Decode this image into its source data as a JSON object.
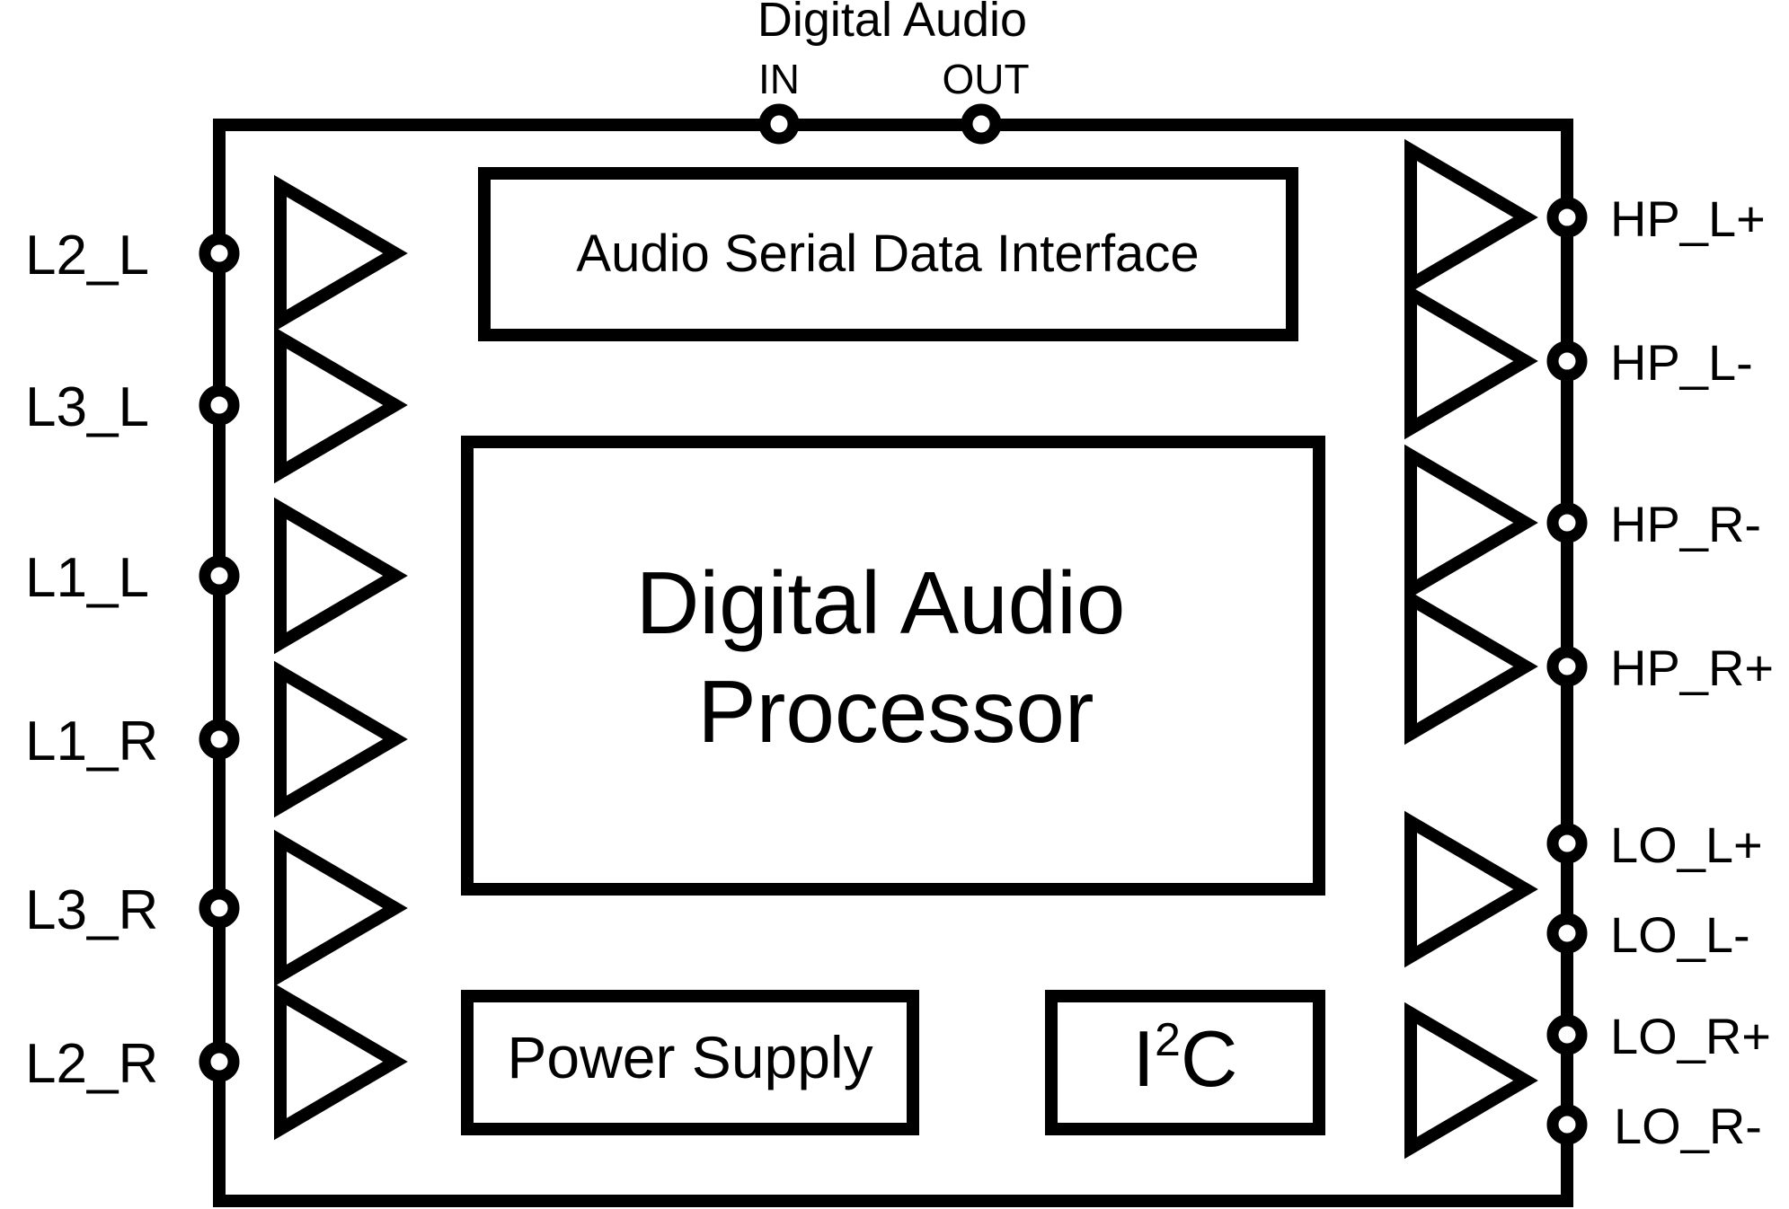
{
  "diagram": {
    "colors": {
      "stroke": "#000000",
      "background": "#ffffff"
    },
    "top_header": "Digital Audio",
    "top_pins": [
      {
        "id": "in",
        "label": "IN"
      },
      {
        "id": "out",
        "label": "OUT"
      }
    ],
    "blocks": {
      "serial_interface": "Audio Serial Data Interface",
      "processor_line1": "Digital Audio",
      "processor_line2": "Processor",
      "power_supply": "Power Supply",
      "i2c_base": "I",
      "i2c_sup": "2",
      "i2c_tail": "C"
    },
    "left_pins": [
      "L2_L",
      "L3_L",
      "L1_L",
      "L1_R",
      "L3_R",
      "L2_R"
    ],
    "right_pins": [
      "HP_L+",
      "HP_L-",
      "HP_R-",
      "HP_R+",
      "LO_L+",
      "LO_L-",
      "LO_R+",
      "LO_R-"
    ],
    "left_amplifier_count": 6,
    "right_amplifier_groups": [
      "HP_L+",
      "HP_L-",
      "HP_R-",
      "HP_R+",
      "LO_L",
      "LO_R"
    ]
  }
}
